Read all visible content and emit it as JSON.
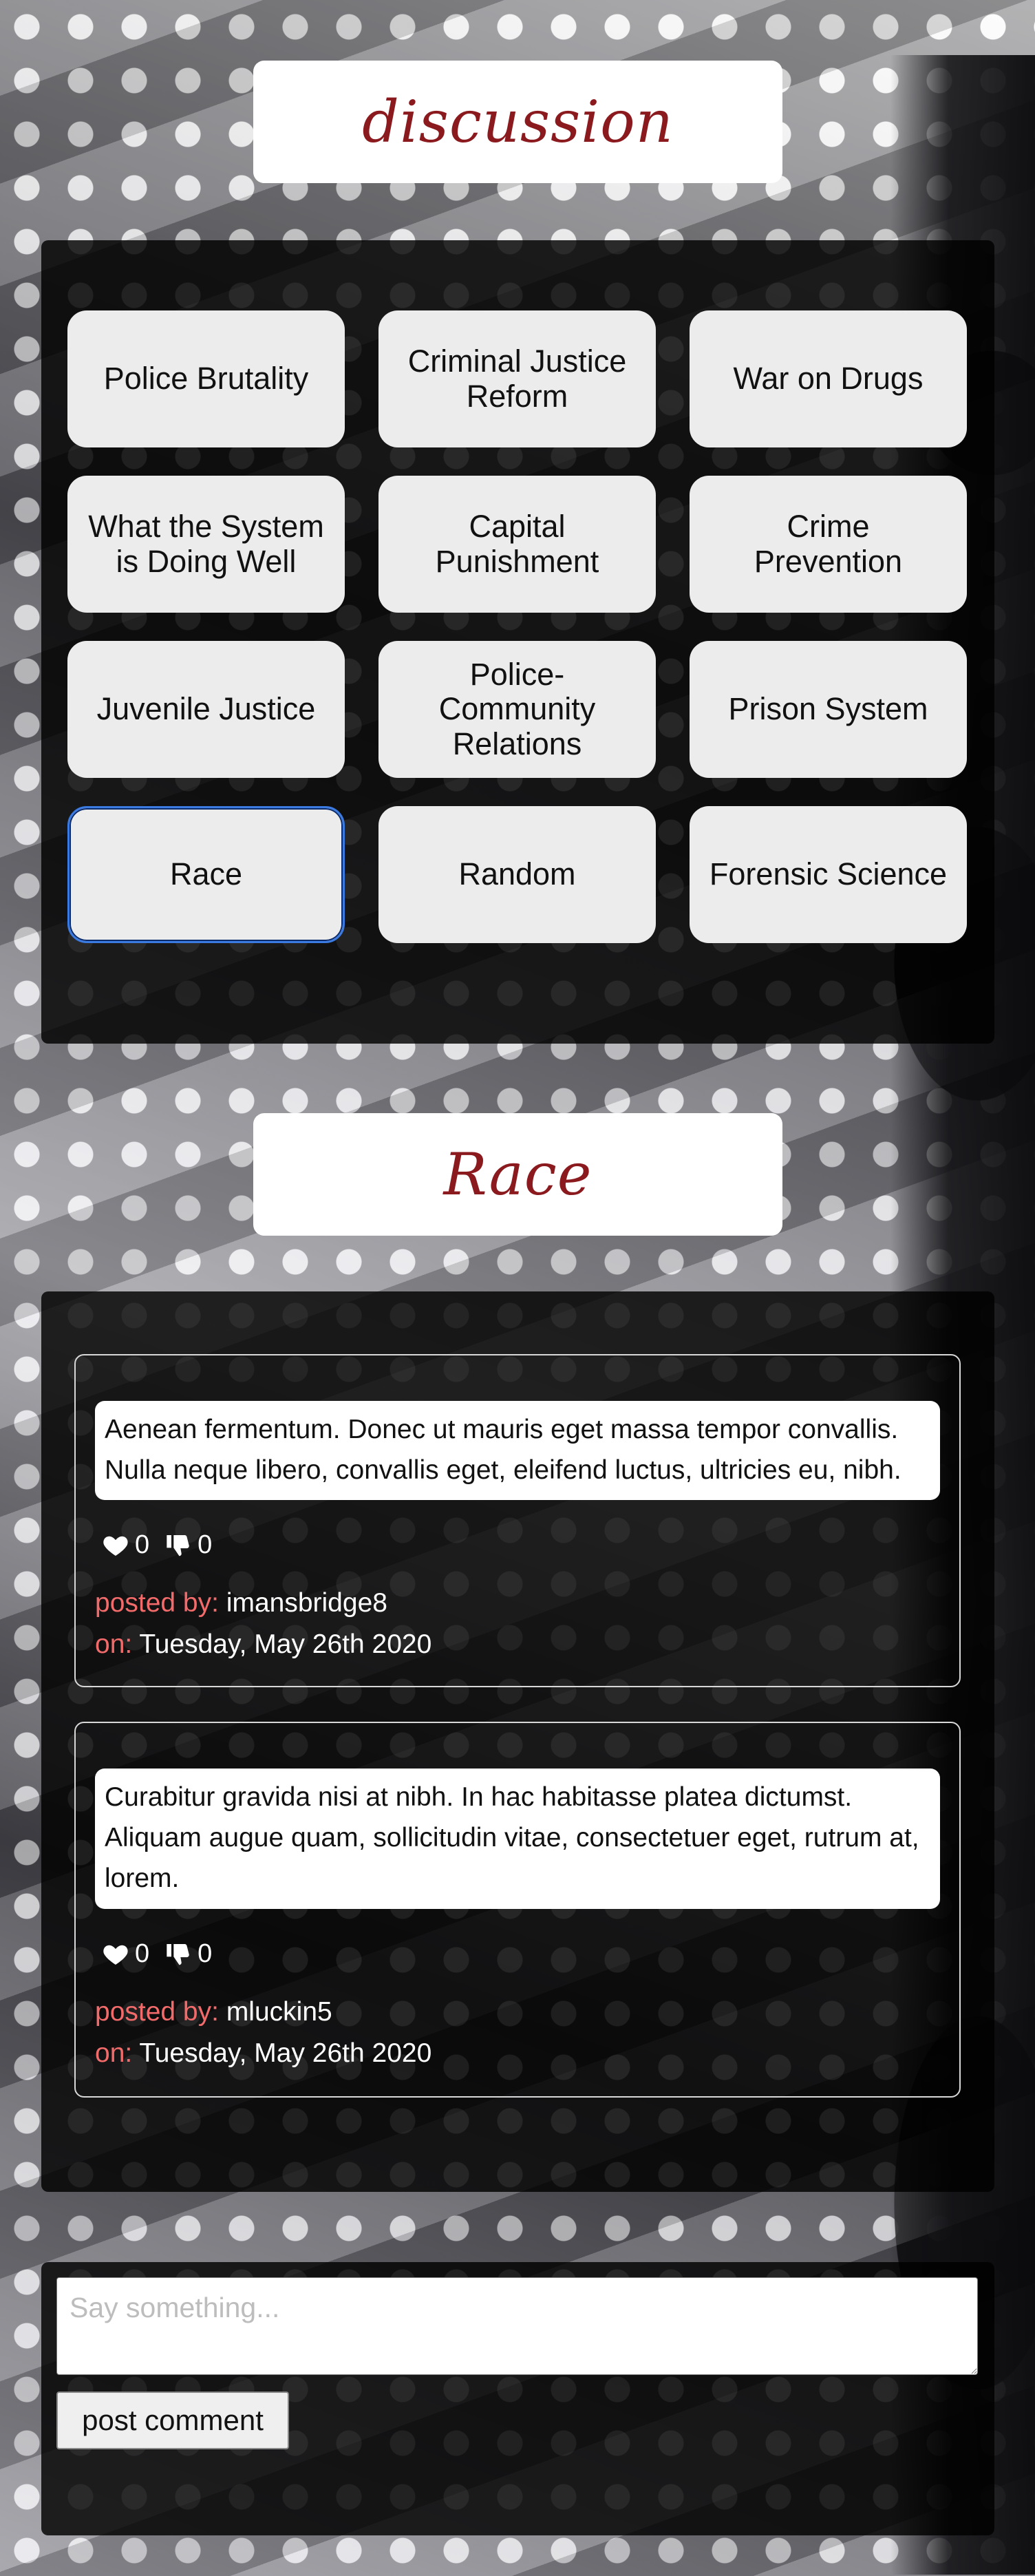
{
  "header": {
    "title": "discussion"
  },
  "topics": [
    {
      "label": "Police Brutality"
    },
    {
      "label": "Criminal Justice Reform"
    },
    {
      "label": "War on Drugs"
    },
    {
      "label": "What the System is Doing Well"
    },
    {
      "label": "Capital Punishment"
    },
    {
      "label": "Crime Prevention"
    },
    {
      "label": "Juvenile Justice"
    },
    {
      "label": "Police-Community Relations"
    },
    {
      "label": "Prison System"
    },
    {
      "label": "Race"
    },
    {
      "label": "Random"
    },
    {
      "label": "Forensic Science"
    }
  ],
  "selected_topic": {
    "title": "Race"
  },
  "comments": [
    {
      "text": "Aenean fermentum. Donec ut mauris eget massa tempor convallis. Nulla neque libero, convallis eget, eleifend luctus, ultricies eu, nibh.",
      "likes": "0",
      "dislikes": "0",
      "posted_by_label": "posted by:",
      "author": "imansbridge8",
      "on_label": "on:",
      "date": "Tuesday, May 26th 2020"
    },
    {
      "text": "Curabitur gravida nisi at nibh. In hac habitasse platea dictumst. Aliquam augue quam, sollicitudin vitae, consectetuer eget, rutrum at, lorem.",
      "likes": "0",
      "dislikes": "0",
      "posted_by_label": "posted by:",
      "author": "mluckin5",
      "on_label": "on:",
      "date": "Tuesday, May 26th 2020"
    }
  ],
  "compose": {
    "placeholder": "Say something...",
    "submit_label": "post comment"
  },
  "icons": {
    "like": "heart-icon",
    "dislike": "thumbs-down-icon"
  },
  "colors": {
    "title": "#8b1a1f",
    "meta_label": "#f26b6b",
    "active_border": "#3b7ae0"
  }
}
